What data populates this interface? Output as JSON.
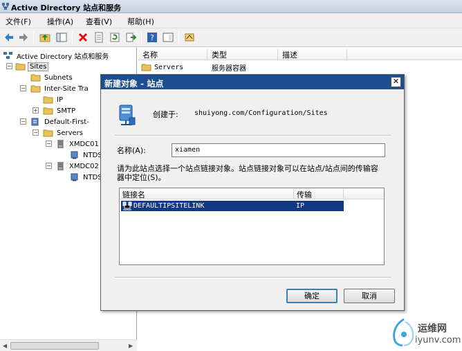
{
  "window": {
    "title": "Active Directory 站点和服务"
  },
  "menu": [
    "文件(F)",
    "操作(A)",
    "查看(V)",
    "帮助(H)"
  ],
  "toolbar": [
    "back-icon",
    "forward-icon",
    "up-folder-icon",
    "show-tree-icon",
    "delete-icon",
    "properties-icon",
    "refresh-icon",
    "export-icon",
    "help-icon",
    "view-icon",
    "new-site-icon"
  ],
  "tree": {
    "root": "Active Directory 站点和服务",
    "sites": "Sites",
    "subnets": "Subnets",
    "inter_site": "Inter-Site Tra",
    "ip": "IP",
    "smtp": "SMTP",
    "default_site": "Default-First-",
    "servers": "Servers",
    "server1": "XMDC01",
    "ntds1": "NTDS",
    "server2": "XMDC02",
    "ntds2": "NTDS"
  },
  "list": {
    "headers": [
      "名称",
      "类型",
      "描述"
    ],
    "rows": [
      {
        "name": "Servers",
        "type": "服务器容器",
        "desc": ""
      }
    ]
  },
  "dialog": {
    "title": "新建对象 - 站点",
    "close": "✕",
    "created_label": "创建于:",
    "created_path": "shuiyong.com/Configuration/Sites",
    "name_label": "名称(A):",
    "name_value": "xiamen",
    "hint": "请为此站点选择一个站点链接对象。站点链接对象可以在站点/站点间的传输容器中定位(S)。",
    "grid_headers": [
      "链接名",
      "传输"
    ],
    "grid_rows": [
      {
        "name": "DEFAULTIPSITELINK",
        "transport": "IP"
      }
    ],
    "ok": "确定",
    "cancel": "取消"
  },
  "watermark": {
    "cn": "运维网",
    "url": "iyunv.com"
  },
  "colors": {
    "dialog_title": "#1d4e8f",
    "selection": "#123a82",
    "folder": "#e8c35a"
  }
}
